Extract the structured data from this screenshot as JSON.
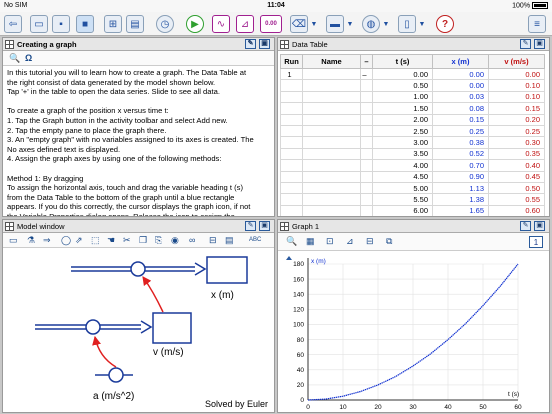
{
  "status": {
    "carrier": "No SIM",
    "time": "11:04",
    "battery": "100%"
  },
  "toolbar": {
    "icons": [
      "exit-icon",
      "open-folder-icon",
      "save-icon",
      "stop-icon",
      "model-icon",
      "activity-icon",
      "stopwatch-icon",
      "play-icon",
      "graph-icon",
      "chart-icon",
      "number-icon",
      "eraser-icon",
      "screen-layout-icon",
      "globe-icon",
      "page-icon",
      "help-icon",
      "document-icon"
    ],
    "number_label": "0.00"
  },
  "doc_panel": {
    "title": "Creating a graph",
    "tools": {
      "search": "🔍",
      "omega": "Ω"
    },
    "lines": [
      "In this tutorial you will to learn how to create a graph. The Data Table at",
      "the right consist of data generated by the model shown below.",
      "Tap '+' in the table to open the data series. Slide to see all data.",
      "",
      "To create a graph of the position x versus time t:",
      "1. Tap the Graph button in the activity toolbar and select Add new.",
      "2. Tap the empty pane to place the graph there.",
      "3. An \"empty graph\" with no variables assigned to its axes is created. The",
      "No axes defined text is displayed.",
      "4. Assign the graph axes by using one of the following methods:",
      "",
      "Method 1: By dragging",
      "To assign the horizontal axis, touch and drag the variable heading t (s)",
      "from the Data Table to the bottom of the graph until a blue rectangle",
      "appears. If you do this correctly, the cursor displays the graph icon, if not",
      "the Variable Properties dialog opens. Release the icon to assign the"
    ]
  },
  "table_panel": {
    "title": "Data Table",
    "headers": {
      "run": "Run",
      "name": "Name",
      "sep": "–",
      "t": "t (s)",
      "x": "x (m)",
      "v": "v (m/s)"
    },
    "run_row": {
      "run": "1",
      "sep": "–"
    },
    "rows": [
      [
        "0.00",
        "0.00",
        "0.00"
      ],
      [
        "0.50",
        "0.00",
        "0.10"
      ],
      [
        "1.00",
        "0.03",
        "0.10"
      ],
      [
        "1.50",
        "0.08",
        "0.15"
      ],
      [
        "2.00",
        "0.15",
        "0.20"
      ],
      [
        "2.50",
        "0.25",
        "0.25"
      ],
      [
        "3.00",
        "0.38",
        "0.30"
      ],
      [
        "3.50",
        "0.52",
        "0.35"
      ],
      [
        "4.00",
        "0.70",
        "0.40"
      ],
      [
        "4.50",
        "0.90",
        "0.45"
      ],
      [
        "5.00",
        "1.13",
        "0.50"
      ],
      [
        "5.50",
        "1.38",
        "0.55"
      ],
      [
        "6.00",
        "1.65",
        "0.60"
      ],
      [
        "6.50",
        "1.95",
        "0.65"
      ]
    ]
  },
  "model_panel": {
    "title": "Model window",
    "labels": {
      "x": "x (m)",
      "v": "v (m/s)",
      "a": "a (m/s^2)"
    },
    "solved": "Solved by Euler"
  },
  "graph_panel": {
    "title": "Graph 1",
    "number": "1"
  },
  "colors": {
    "accent": "#1a4a9a",
    "curve": "#1030d0",
    "link": "#e02020"
  },
  "chart_data": {
    "type": "line",
    "title": "",
    "xlabel": "t (s)",
    "ylabel": "x (m)",
    "xlim": [
      0,
      60
    ],
    "ylim": [
      0,
      180
    ],
    "xticks": [
      0,
      10,
      20,
      30,
      40,
      50,
      60
    ],
    "yticks": [
      0,
      20,
      40,
      60,
      80,
      100,
      120,
      140,
      160,
      180
    ],
    "grid": true,
    "series": [
      {
        "x": [
          0,
          5,
          10,
          15,
          20,
          25,
          30,
          35,
          40,
          45,
          50,
          55,
          60
        ],
        "y": [
          0,
          1.2,
          5,
          11.2,
          20,
          31,
          45,
          61,
          80,
          101,
          125,
          151,
          180
        ]
      }
    ]
  }
}
